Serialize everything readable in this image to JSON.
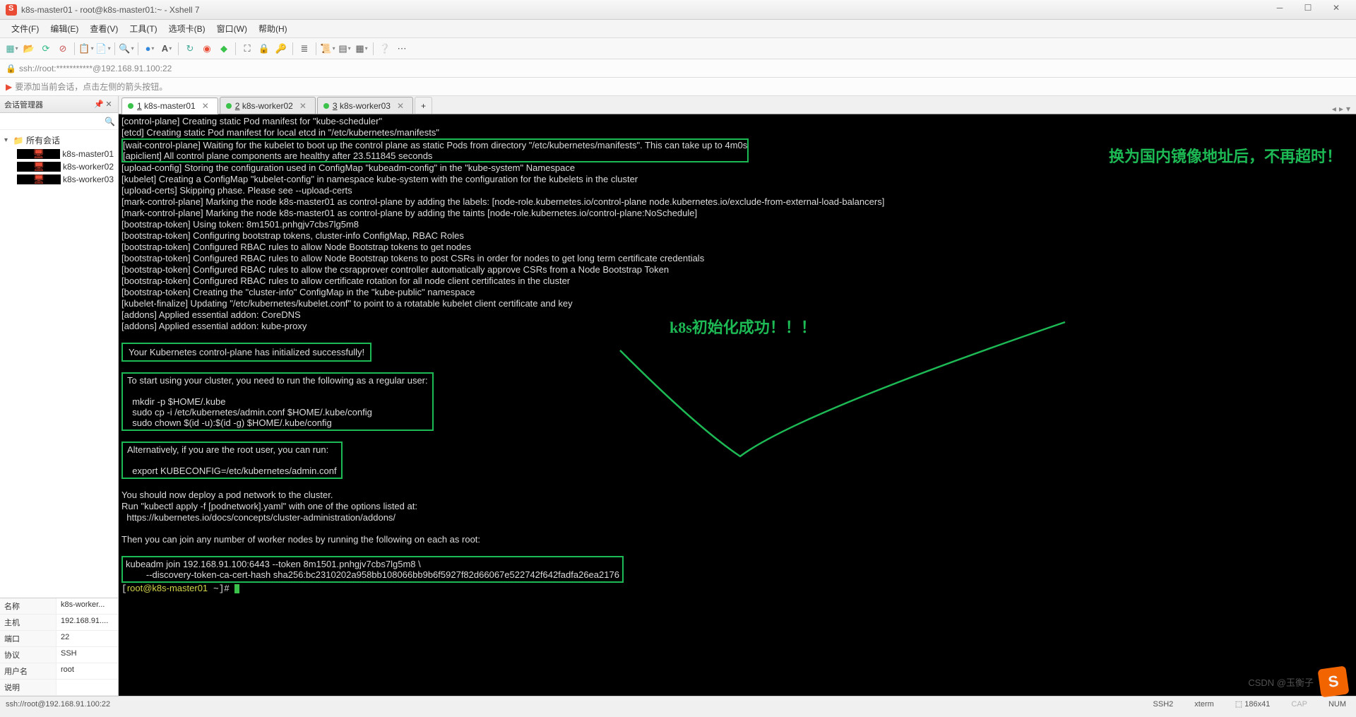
{
  "title": "k8s-master01 - root@k8s-master01:~ - Xshell 7",
  "menu": [
    "文件(F)",
    "编辑(E)",
    "查看(V)",
    "工具(T)",
    "选项卡(B)",
    "窗口(W)",
    "帮助(H)"
  ],
  "address": "ssh://root:***********@192.168.91.100:22",
  "tip": "要添加当前会话，点击左侧的箭头按钮。",
  "sidebar": {
    "title": "会话管理器",
    "root": "所有会话",
    "items": [
      "k8s-master01",
      "k8s-worker02",
      "k8s-worker03"
    ]
  },
  "props": {
    "name_k": "名称",
    "name_v": "k8s-worker...",
    "host_k": "主机",
    "host_v": "192.168.91....",
    "port_k": "端口",
    "port_v": "22",
    "proto_k": "协议",
    "proto_v": "SSH",
    "user_k": "用户名",
    "user_v": "root",
    "desc_k": "说明",
    "desc_v": ""
  },
  "tabs": [
    {
      "n": "1",
      "label": "k8s-master01",
      "active": true
    },
    {
      "n": "2",
      "label": "k8s-worker02",
      "active": false
    },
    {
      "n": "3",
      "label": "k8s-worker03",
      "active": false
    }
  ],
  "terminal": {
    "l0": "[control-plane] Creating static Pod manifest for \"kube-scheduler\"",
    "l1": "[etcd] Creating static Pod manifest for local etcd in \"/etc/kubernetes/manifests\"",
    "l2": "[wait-control-plane] Waiting for the kubelet to boot up the control plane as static Pods from directory \"/etc/kubernetes/manifests\". This can take up to 4m0s",
    "l3": "[apiclient] All control plane components are healthy after 23.511845 seconds",
    "l4": "[upload-config] Storing the configuration used in ConfigMap \"kubeadm-config\" in the \"kube-system\" Namespace",
    "l5": "[kubelet] Creating a ConfigMap \"kubelet-config\" in namespace kube-system with the configuration for the kubelets in the cluster",
    "l6": "[upload-certs] Skipping phase. Please see --upload-certs",
    "l7": "[mark-control-plane] Marking the node k8s-master01 as control-plane by adding the labels: [node-role.kubernetes.io/control-plane node.kubernetes.io/exclude-from-external-load-balancers]",
    "l8": "[mark-control-plane] Marking the node k8s-master01 as control-plane by adding the taints [node-role.kubernetes.io/control-plane:NoSchedule]",
    "l9": "[bootstrap-token] Using token: 8m1501.pnhgjv7cbs7lg5m8",
    "l10": "[bootstrap-token] Configuring bootstrap tokens, cluster-info ConfigMap, RBAC Roles",
    "l11": "[bootstrap-token] Configured RBAC rules to allow Node Bootstrap tokens to get nodes",
    "l12": "[bootstrap-token] Configured RBAC rules to allow Node Bootstrap tokens to post CSRs in order for nodes to get long term certificate credentials",
    "l13": "[bootstrap-token] Configured RBAC rules to allow the csrapprover controller automatically approve CSRs from a Node Bootstrap Token",
    "l14": "[bootstrap-token] Configured RBAC rules to allow certificate rotation for all node client certificates in the cluster",
    "l15": "[bootstrap-token] Creating the \"cluster-info\" ConfigMap in the \"kube-public\" namespace",
    "l16": "[kubelet-finalize] Updating \"/etc/kubernetes/kubelet.conf\" to point to a rotatable kubelet client certificate and key",
    "l17": "[addons] Applied essential addon: CoreDNS",
    "l18": "[addons] Applied essential addon: kube-proxy",
    "l19": "Your Kubernetes control-plane has initialized successfully!",
    "l20": "To start using your cluster, you need to run the following as a regular user:",
    "l21": "  mkdir -p $HOME/.kube",
    "l22": "  sudo cp -i /etc/kubernetes/admin.conf $HOME/.kube/config",
    "l23": "  sudo chown $(id -u):$(id -g) $HOME/.kube/config",
    "l24": "Alternatively, if you are the root user, you can run:",
    "l25": "  export KUBECONFIG=/etc/kubernetes/admin.conf",
    "l26": "You should now deploy a pod network to the cluster.",
    "l27": "Run \"kubectl apply -f [podnetwork].yaml\" with one of the options listed at:",
    "l28": "  https://kubernetes.io/docs/concepts/cluster-administration/addons/",
    "l29": "Then you can join any number of worker nodes by running the following on each as root:",
    "l30": "kubeadm join 192.168.91.100:6443 --token 8m1501.pnhgjv7cbs7lg5m8 \\",
    "l31": "        --discovery-token-ca-cert-hash sha256:bc2310202a958bb108066bb9b6f5927f82d66067e522742f642fadfa26ea2176",
    "prompt_u": "root@k8s-master01",
    "prompt_p": "~",
    "prompt_h": "#"
  },
  "annotations": {
    "a1": "换为国内镜像地址后，不再超时！",
    "a2": "k8s初始化成功！！！"
  },
  "status": {
    "left": "ssh://root@192.168.91.100:22",
    "ssh": "SSH2",
    "term": "xterm",
    "size": "186x41",
    "caps": "CAP",
    "num": "NUM"
  }
}
